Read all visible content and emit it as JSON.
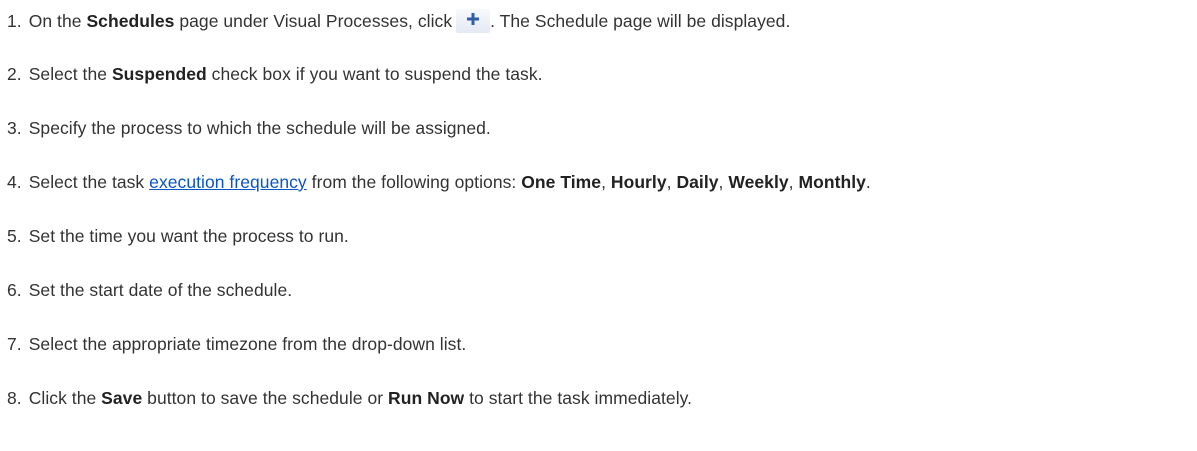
{
  "steps": [
    {
      "num": "1.",
      "parts": [
        {
          "t": "On the "
        },
        {
          "t": "Schedules",
          "b": true
        },
        {
          "t": " page under Visual Processes, click"
        },
        {
          "icon": "plus-icon"
        },
        {
          "t": ". The Schedule page will be displayed."
        }
      ]
    },
    {
      "num": "2.",
      "parts": [
        {
          "t": "Select the "
        },
        {
          "t": "Suspended",
          "b": true
        },
        {
          "t": " check box if you want to suspend the task."
        }
      ]
    },
    {
      "num": "3.",
      "parts": [
        {
          "t": "Specify the process to which the schedule will be assigned."
        }
      ]
    },
    {
      "num": "4.",
      "parts": [
        {
          "t": "Select the task "
        },
        {
          "t": "execution frequency",
          "link": true
        },
        {
          "t": " from the following options: "
        },
        {
          "t": "One Time",
          "b": true
        },
        {
          "t": ", "
        },
        {
          "t": "Hourly",
          "b": true
        },
        {
          "t": ", "
        },
        {
          "t": "Daily",
          "b": true
        },
        {
          "t": ", "
        },
        {
          "t": "Weekly",
          "b": true
        },
        {
          "t": ", "
        },
        {
          "t": "Monthly",
          "b": true
        },
        {
          "t": "."
        }
      ]
    },
    {
      "num": "5.",
      "parts": [
        {
          "t": "Set the time you want the process to run."
        }
      ]
    },
    {
      "num": "6.",
      "parts": [
        {
          "t": "Set the start date of the schedule."
        }
      ]
    },
    {
      "num": "7.",
      "parts": [
        {
          "t": "Select the appropriate timezone from the drop-down list."
        }
      ]
    },
    {
      "num": "8.",
      "parts": [
        {
          "t": "Click the "
        },
        {
          "t": "Save",
          "b": true
        },
        {
          "t": " button to save the schedule or "
        },
        {
          "t": "Run Now",
          "b": true
        },
        {
          "t": " to start the task immediately."
        }
      ]
    }
  ],
  "colors": {
    "text": "#333333",
    "link": "#0b55c4",
    "icon": "#2f5fa8"
  }
}
